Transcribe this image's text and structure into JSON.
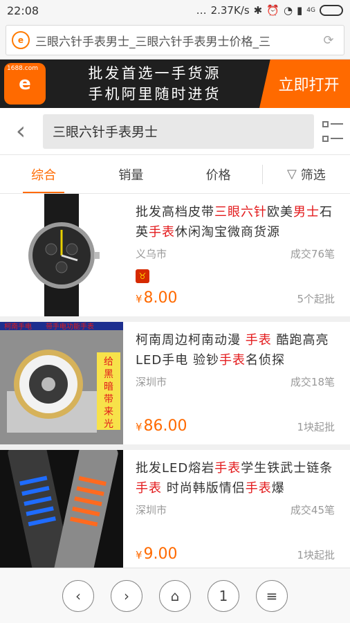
{
  "status": {
    "time": "22:08",
    "speed": "2.37K/s",
    "network": "4G"
  },
  "browser": {
    "url_text": "三眼六针手表男士_三眼六针手表男士价格_三",
    "site_icon": "1688"
  },
  "banner": {
    "logo_small": "1688.com",
    "line1": "批发首选一手货源",
    "line2": "手机阿里随时进货",
    "open_button": "立即打开"
  },
  "search": {
    "query": "三眼六针手表男士"
  },
  "tabs": [
    {
      "label": "综合"
    },
    {
      "label": "销量"
    },
    {
      "label": "价格"
    },
    {
      "label": "筛选"
    }
  ],
  "products": [
    {
      "title_parts": [
        "批发高档皮带",
        "三眼六针",
        "欧美",
        "男士",
        "石英",
        "手表",
        "休闲淘宝微商货源"
      ],
      "location": "义乌市",
      "deals": "成交76笔",
      "currency": "¥",
      "price": "8.00",
      "moq": "5个起批"
    },
    {
      "title_parts": [
        "柯南周边柯南动漫 ",
        "手表",
        " 酷跑高亮LED手电 验钞",
        "手表",
        "名侦探"
      ],
      "location": "深圳市",
      "deals": "成交18笔",
      "currency": "¥",
      "price": "86.00",
      "moq": "1块起批",
      "image_text": [
        "柯南手电",
        "带手电功能手表",
        "给黑暗带来光明"
      ]
    },
    {
      "title_parts": [
        "批发LED熔岩",
        "手表",
        "学生铁武士链条",
        "手表",
        " 时尚韩版情侣",
        "手表",
        "爆"
      ],
      "location": "深圳市",
      "deals": "成交45笔",
      "currency": "¥",
      "price": "9.00",
      "moq": "1块起批"
    }
  ],
  "bottom_nav": {
    "page": "1"
  },
  "colors": {
    "accent": "#ff6a00",
    "highlight": "#e3191b"
  }
}
